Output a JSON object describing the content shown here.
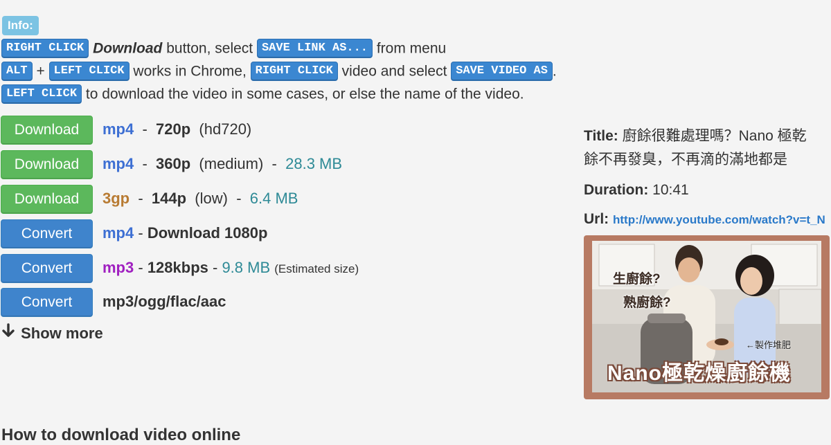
{
  "info": {
    "badge": "Info:",
    "line1": {
      "key1": "RIGHT CLICK",
      "emph": "Download",
      "text1": " button, select ",
      "key2": "SAVE LINK AS...",
      "text2": " from menu"
    },
    "line2": {
      "key1": "ALT",
      "plus": " + ",
      "key2": "LEFT CLICK",
      "text1": " works in Chrome, ",
      "key3": "RIGHT CLICK",
      "text2": " video and select ",
      "key4": "SAVE VIDEO AS",
      "text3": "."
    },
    "line3": {
      "key1": "LEFT CLICK",
      "text1": " to download the video in some cases, or else the name of the video."
    }
  },
  "rows": [
    {
      "button": "Download",
      "format": "mp4",
      "resolution": "720p",
      "quality": "(hd720)",
      "size": ""
    },
    {
      "button": "Download",
      "format": "mp4",
      "resolution": "360p",
      "quality": "(medium)",
      "size": "28.3 MB"
    },
    {
      "button": "Download",
      "format": "3gp",
      "resolution": "144p",
      "quality": "(low)",
      "size": "6.4 MB"
    },
    {
      "button": "Convert",
      "format": "mp4",
      "text": "Download 1080p"
    },
    {
      "button": "Convert",
      "format": "mp3",
      "bitrate": "128kbps",
      "size": "9.8 MB",
      "note": "(Estimated size)"
    },
    {
      "button": "Convert",
      "format": "mp3/ogg/flac/aac"
    }
  ],
  "show_more": "Show more",
  "cut_heading": "How to download video online",
  "video": {
    "title_label": "Title:",
    "title_line1": "廚餘很難處理嗎？Nano 極乾",
    "title_line2": "餘不再發臭，不再滴的滿地都是",
    "duration_label": "Duration:",
    "duration": "10:41",
    "url_label": "Url:",
    "url": "http://www.youtube.com/watch?v=t_N",
    "thumb_text1": "生廚餘?",
    "thumb_text2": "熟廚餘?",
    "thumb_text3": "←製作堆肥",
    "thumb_banner": "Nano極乾燥廚餘機"
  },
  "colors": {
    "green": "#5cb85c",
    "blue": "#3f84cc",
    "mp4": "#3d6fd3",
    "3gp": "#b87b33",
    "mp3": "#a020c0",
    "size": "#2e8a96"
  }
}
